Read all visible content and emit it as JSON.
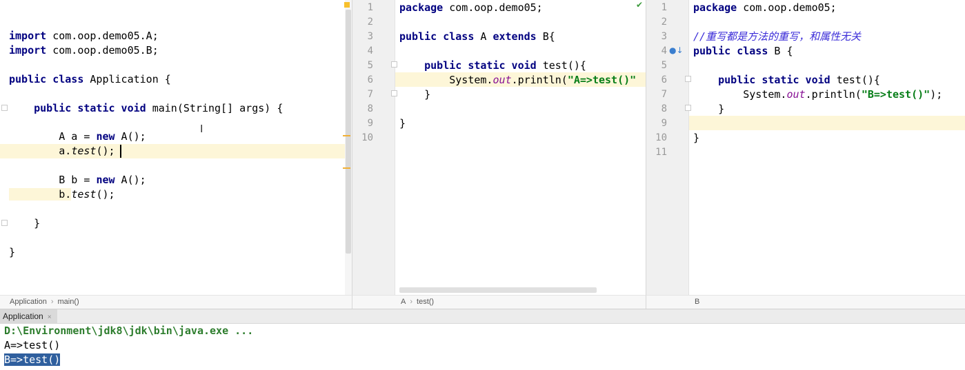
{
  "pane1": {
    "lines": [
      {
        "parts": [
          {
            "t": "import",
            "c": "kw"
          },
          {
            "t": " com.oop.demo05.A;"
          }
        ]
      },
      {
        "parts": [
          {
            "t": "import",
            "c": "kw"
          },
          {
            "t": " com.oop.demo05.B;"
          }
        ]
      },
      {
        "parts": [
          {
            "t": "public class",
            "c": "kw"
          },
          {
            "t": " Application {"
          }
        ]
      },
      {
        "parts": [
          {
            "t": "    "
          },
          {
            "t": "public static void",
            "c": "kw"
          },
          {
            "t": " main(String[] args) {"
          }
        ]
      },
      {
        "parts": [
          {
            "t": "        A a = "
          },
          {
            "t": "new",
            "c": "kw"
          },
          {
            "t": " A();"
          }
        ]
      },
      {
        "parts": [
          {
            "t": "        a.",
            "c": "hlt"
          },
          {
            "t": "test",
            "c": "ital"
          },
          {
            "t": "();"
          }
        ]
      },
      {
        "parts": [
          {
            "t": "        B b = "
          },
          {
            "t": "new",
            "c": "kw"
          },
          {
            "t": " A();"
          }
        ]
      },
      {
        "parts": [
          {
            "t": "        b.",
            "c": "hlt"
          },
          {
            "t": "test",
            "c": "ital"
          },
          {
            "t": "();"
          }
        ]
      },
      {
        "parts": [
          {
            "t": "    }"
          }
        ]
      },
      {
        "parts": [
          {
            "t": "}"
          }
        ]
      }
    ],
    "breadcrumb": [
      "Application",
      "main()"
    ]
  },
  "pane2": {
    "line_numbers": [
      "1",
      "2",
      "3",
      "4",
      "5",
      "6",
      "7",
      "8",
      "9",
      "10"
    ],
    "lines": [
      {
        "parts": [
          {
            "t": "package",
            "c": "kw"
          },
          {
            "t": " com.oop.demo05;"
          }
        ]
      },
      {
        "parts": []
      },
      {
        "parts": [
          {
            "t": "public class",
            "c": "kw"
          },
          {
            "t": " A "
          },
          {
            "t": "extends",
            "c": "kw"
          },
          {
            "t": " B{"
          }
        ]
      },
      {
        "parts": []
      },
      {
        "parts": [
          {
            "t": "    "
          },
          {
            "t": "public static void",
            "c": "kw"
          },
          {
            "t": " test(){"
          }
        ]
      },
      {
        "parts": [
          {
            "t": "        System."
          },
          {
            "t": "out",
            "c": "fld"
          },
          {
            "t": ".println("
          },
          {
            "t": "\"A=>test()\"",
            "c": "str"
          }
        ]
      },
      {
        "parts": [
          {
            "t": "    }"
          }
        ]
      },
      {
        "parts": []
      },
      {
        "parts": [
          {
            "t": "}"
          }
        ]
      },
      {
        "parts": []
      }
    ],
    "breadcrumb": [
      "A",
      "test()"
    ]
  },
  "pane3": {
    "line_numbers": [
      "1",
      "2",
      "3",
      "4",
      "5",
      "6",
      "7",
      "8",
      "9",
      "10",
      "11"
    ],
    "lines": [
      {
        "parts": [
          {
            "t": "package",
            "c": "kw"
          },
          {
            "t": " com.oop.demo05;"
          }
        ]
      },
      {
        "parts": []
      },
      {
        "parts": [
          {
            "t": "//重写都是方法的重写，和属性无关",
            "c": "cmt"
          }
        ]
      },
      {
        "parts": [
          {
            "t": "public class",
            "c": "kw"
          },
          {
            "t": " B {"
          }
        ]
      },
      {
        "parts": []
      },
      {
        "parts": [
          {
            "t": "    "
          },
          {
            "t": "public static void",
            "c": "kw"
          },
          {
            "t": " test(){"
          }
        ]
      },
      {
        "parts": [
          {
            "t": "        System."
          },
          {
            "t": "out",
            "c": "fld"
          },
          {
            "t": ".println("
          },
          {
            "t": "\"B=>test()\"",
            "c": "str"
          },
          {
            "t": ");"
          }
        ]
      },
      {
        "parts": [
          {
            "t": "    }"
          }
        ]
      },
      {
        "parts": []
      },
      {
        "parts": [
          {
            "t": "}"
          }
        ]
      },
      {
        "parts": []
      }
    ],
    "breadcrumb": [
      "B"
    ]
  },
  "run": {
    "tab_label": "Application",
    "console": [
      "D:\\Environment\\jdk8\\jdk\\bin\\java.exe ...",
      "A=>test()",
      "B=>test()"
    ]
  },
  "colors": {
    "keyword": "#000080",
    "string": "#067d17",
    "field": "#871094",
    "comment": "#3a2bd8",
    "current_line": "#fdf6d8",
    "selection": "#2f5f9e"
  }
}
